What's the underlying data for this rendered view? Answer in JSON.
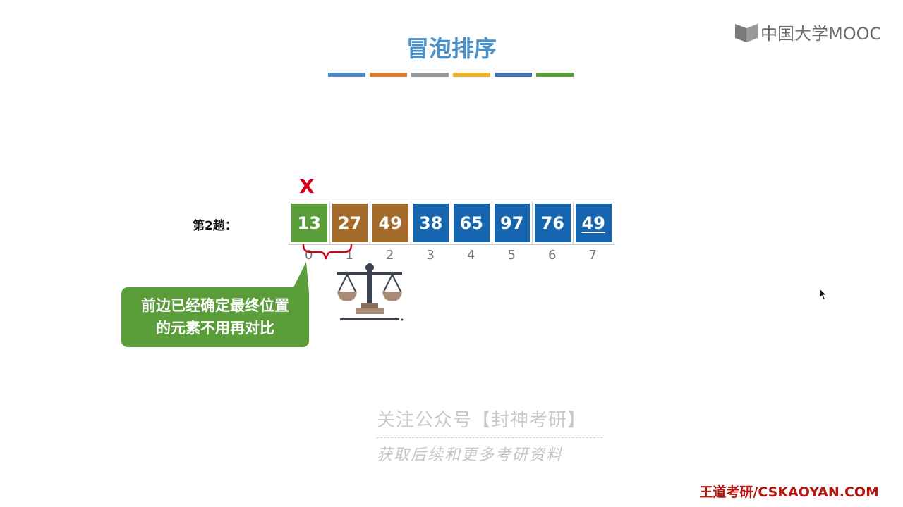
{
  "logo": {
    "text": "中国大学MOOC"
  },
  "slide": {
    "title": "冒泡排序",
    "color_bar": [
      "#4a8ac9",
      "#e07b2c",
      "#9a9a9a",
      "#f0b323",
      "#3b6eb5",
      "#5a9e3a"
    ]
  },
  "pass_label": "第2趟：",
  "array": {
    "cells": [
      {
        "value": "13",
        "color": "#5a9e3a",
        "underline": false
      },
      {
        "value": "27",
        "color": "#a36a2a",
        "underline": false
      },
      {
        "value": "49",
        "color": "#a36a2a",
        "underline": false
      },
      {
        "value": "38",
        "color": "#1566ae",
        "underline": false
      },
      {
        "value": "65",
        "color": "#1566ae",
        "underline": false
      },
      {
        "value": "97",
        "color": "#1566ae",
        "underline": false
      },
      {
        "value": "76",
        "color": "#1566ae",
        "underline": false
      },
      {
        "value": "49",
        "color": "#1566ae",
        "underline": true
      }
    ],
    "indices": [
      "0",
      "1",
      "2",
      "3",
      "4",
      "5",
      "6",
      "7"
    ]
  },
  "annotations": {
    "cross": "X"
  },
  "callout": {
    "line1": "前边已经确定最终位置",
    "line2": "的元素不用再对比",
    "color": "#5a9e3a"
  },
  "watermark": {
    "line1": "关注公众号【封神考研】",
    "line2": "获取后续和更多考研资料"
  },
  "footer": "王道考研/CSKAOYAN.COM",
  "icons": {
    "logo": "book-logo-icon",
    "scale": "balance-scale-icon",
    "cursor": "mouse-pointer-icon"
  }
}
